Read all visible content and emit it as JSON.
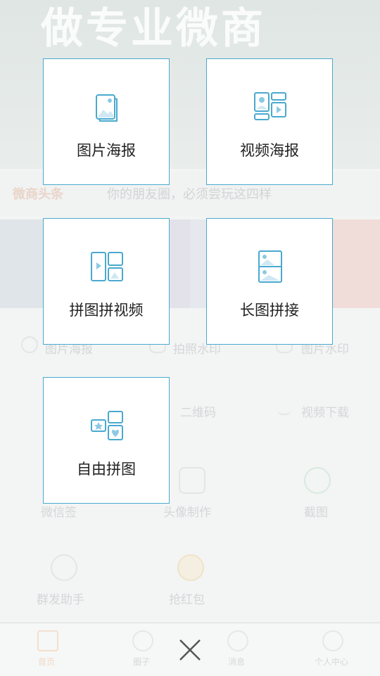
{
  "background_app": {
    "banner_title": "做专业微商",
    "notice": {
      "tag": "微商头条",
      "text": "你的朋友圈，必须尝玩这四样"
    },
    "row1": [
      "图片海报",
      "拍照水印",
      "图片水印"
    ],
    "row2": [
      "二维码",
      "视频下载"
    ],
    "row3": [
      "微信签",
      "头像制作",
      "截图"
    ],
    "row4": [
      "群发助手",
      "抢红包"
    ],
    "tabs": [
      "首页",
      "圈子",
      "消息",
      "个人中心"
    ]
  },
  "menu": {
    "items": [
      {
        "label": "图片海报",
        "icon": "image-poster-icon"
      },
      {
        "label": "视频海报",
        "icon": "video-poster-icon"
      },
      {
        "label": "拼图拼视频",
        "icon": "collage-video-icon"
      },
      {
        "label": "长图拼接",
        "icon": "long-image-stitch-icon"
      },
      {
        "label": "自由拼图",
        "icon": "free-collage-icon"
      }
    ],
    "close_icon": "close-icon",
    "accent_color": "#4aa9cf"
  }
}
